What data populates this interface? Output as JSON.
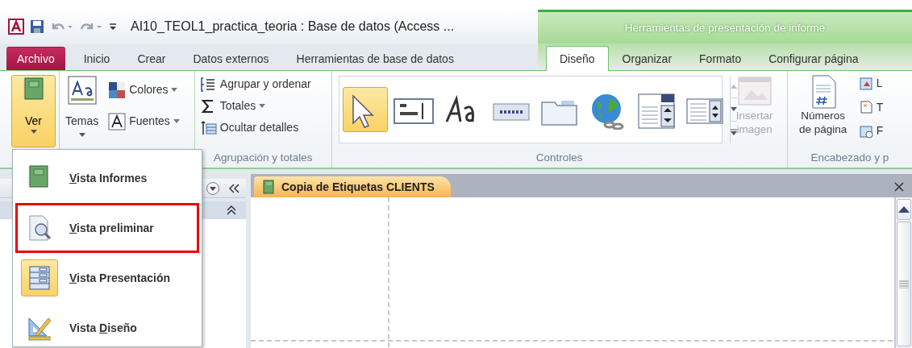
{
  "title_bar": {
    "title": "AI10_TEOL1_practica_teoria : Base de datos (Access ...",
    "contextual_title": "Herramientas de presentación de informe"
  },
  "tabs": [
    {
      "label": "Archivo",
      "kind": "file",
      "selected": false
    },
    {
      "label": "Inicio",
      "kind": "normal",
      "selected": false
    },
    {
      "label": "Crear",
      "kind": "normal",
      "selected": false
    },
    {
      "label": "Datos externos",
      "kind": "normal",
      "selected": false
    },
    {
      "label": "Herramientas de base de datos",
      "kind": "normal",
      "selected": false
    },
    {
      "label": "Diseño",
      "kind": "contextual",
      "selected": true
    },
    {
      "label": "Organizar",
      "kind": "contextual",
      "selected": false
    },
    {
      "label": "Formato",
      "kind": "contextual",
      "selected": false
    },
    {
      "label": "Configurar página",
      "kind": "contextual",
      "selected": false
    }
  ],
  "ribbon": {
    "view_button": {
      "label": "Ver",
      "pressed": true
    },
    "themes": {
      "label": "Temas",
      "colors": "Colores",
      "fonts": "Fuentes"
    },
    "grouping": {
      "items": [
        {
          "kind": "group",
          "label": "Agrupar y ordenar",
          "dropdown": false
        },
        {
          "kind": "sum",
          "label": "Totales",
          "dropdown": true
        },
        {
          "kind": "hide",
          "label": "Ocultar detalles",
          "dropdown": false
        }
      ],
      "group_label": "Agrupación y totales"
    },
    "controls": {
      "tools": [
        {
          "kind": "pointer",
          "selected": true
        },
        {
          "kind": "textbox",
          "selected": false
        },
        {
          "kind": "label",
          "selected": false
        },
        {
          "kind": "button",
          "selected": false
        },
        {
          "kind": "tab",
          "selected": false
        },
        {
          "kind": "hyperlink",
          "selected": false
        },
        {
          "kind": "combo",
          "selected": false
        },
        {
          "kind": "listbox",
          "selected": false
        }
      ],
      "insert_image": {
        "label": "Insertar imagen",
        "disabled": true
      },
      "group_label": "Controles"
    },
    "header_footer": {
      "page_numbers": "Números de página",
      "side_items": [
        "L",
        "T",
        "F"
      ],
      "group_label": "Encabezado y p"
    }
  },
  "view_menu": {
    "items": [
      {
        "kind": "report",
        "key": "V",
        "after": "ista Informes",
        "selected": false,
        "highlighted": false
      },
      {
        "kind": "preview",
        "key": "V",
        "after": "ista preliminar",
        "selected": false,
        "highlighted": true
      },
      {
        "kind": "layout",
        "key": "V",
        "after": "ista Presentación",
        "selected": true,
        "highlighted": false
      },
      {
        "kind": "design",
        "before": "Vista ",
        "key": "D",
        "after": "iseño",
        "selected": false,
        "highlighted": false
      }
    ]
  },
  "document_tab": {
    "title": "Copia de Etiquetas CLIENTS"
  }
}
